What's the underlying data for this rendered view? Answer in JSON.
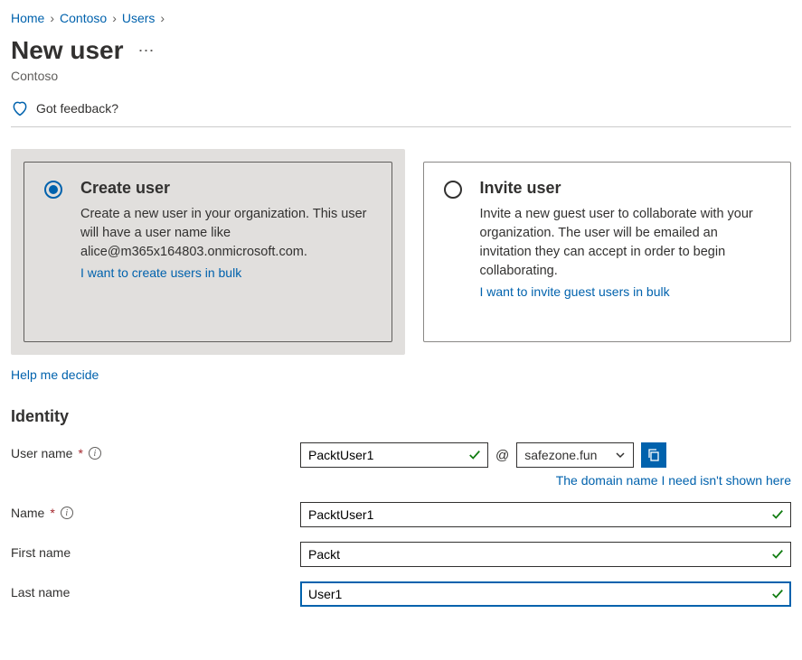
{
  "breadcrumb": {
    "items": [
      "Home",
      "Contoso",
      "Users"
    ]
  },
  "title": "New user",
  "subtitle": "Contoso",
  "feedback_text": "Got feedback?",
  "options": {
    "create": {
      "title": "Create user",
      "desc": "Create a new user in your organization. This user will have a user name like alice@m365x164803.onmicrosoft.com.",
      "link": "I want to create users in bulk"
    },
    "invite": {
      "title": "Invite user",
      "desc": "Invite a new guest user to collaborate with your organization. The user will be emailed an invitation they can accept in order to begin collaborating.",
      "link": "I want to invite guest users in bulk"
    }
  },
  "help_link": "Help me decide",
  "section_identity": "Identity",
  "fields": {
    "username_label": "User name",
    "username_value": "PacktUser1",
    "at": "@",
    "domain_value": "safezone.fun",
    "domain_link": "The domain name I need isn't shown here",
    "name_label": "Name",
    "name_value": "PacktUser1",
    "firstname_label": "First name",
    "firstname_value": "Packt",
    "lastname_label": "Last name",
    "lastname_value": "User1"
  }
}
